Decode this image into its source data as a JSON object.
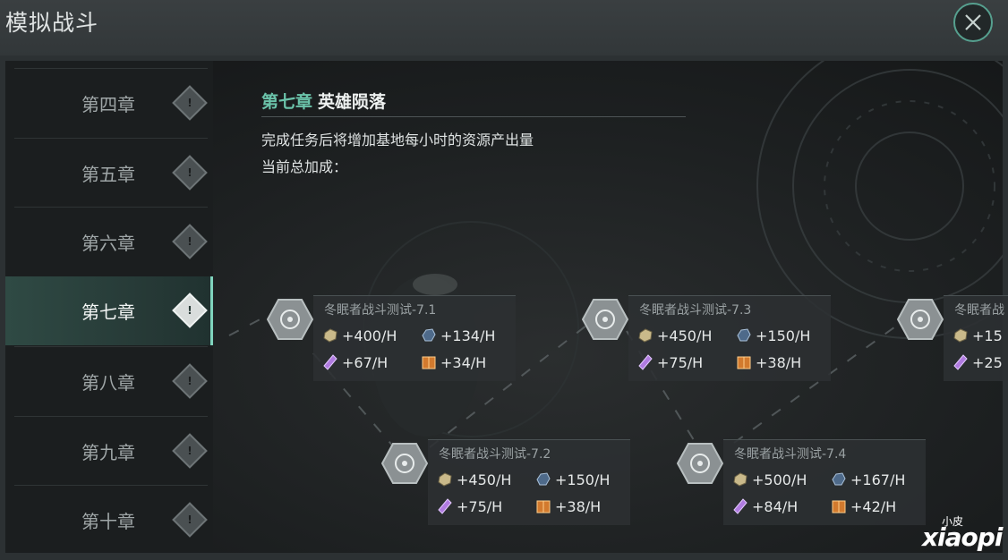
{
  "window": {
    "title": "模拟战斗",
    "close_icon": "close-icon"
  },
  "sidebar": {
    "chapters": [
      {
        "label": "第四章",
        "active": false
      },
      {
        "label": "第五章",
        "active": false
      },
      {
        "label": "第六章",
        "active": false
      },
      {
        "label": "第七章",
        "active": true
      },
      {
        "label": "第八章",
        "active": false
      },
      {
        "label": "第九章",
        "active": false
      },
      {
        "label": "第十章",
        "active": false
      }
    ]
  },
  "chapter": {
    "number": "第七章",
    "name": "英雄陨落",
    "description": "完成任务后将增加基地每小时的资源产出量",
    "bonus_label": "当前总加成："
  },
  "resources": {
    "alloy_icon": "alloy-ore-icon",
    "crystal_icon": "crystal-ore-icon",
    "energy_icon": "energy-crystal-icon",
    "supply_icon": "supply-crate-icon"
  },
  "nodes": [
    {
      "name": "冬眠者战斗测试-7.1",
      "alloy": "+400/H",
      "crystal": "+134/H",
      "energy": "+67/H",
      "supply": "+34/H"
    },
    {
      "name": "冬眠者战斗测试-7.2",
      "alloy": "+450/H",
      "crystal": "+150/H",
      "energy": "+75/H",
      "supply": "+38/H"
    },
    {
      "name": "冬眠者战斗测试-7.3",
      "alloy": "+450/H",
      "crystal": "+150/H",
      "energy": "+75/H",
      "supply": "+38/H"
    },
    {
      "name": "冬眠者战斗测试-7.4",
      "alloy": "+500/H",
      "crystal": "+167/H",
      "energy": "+84/H",
      "supply": "+42/H"
    },
    {
      "name": "冬眠者战",
      "alloy": "+15",
      "crystal": "",
      "energy": "+25",
      "supply": ""
    }
  ],
  "watermark": {
    "small": "小皮",
    "big": "xiaopi"
  },
  "colors": {
    "accent": "#6bc3aa",
    "active_bar": "#7fd3bd"
  }
}
